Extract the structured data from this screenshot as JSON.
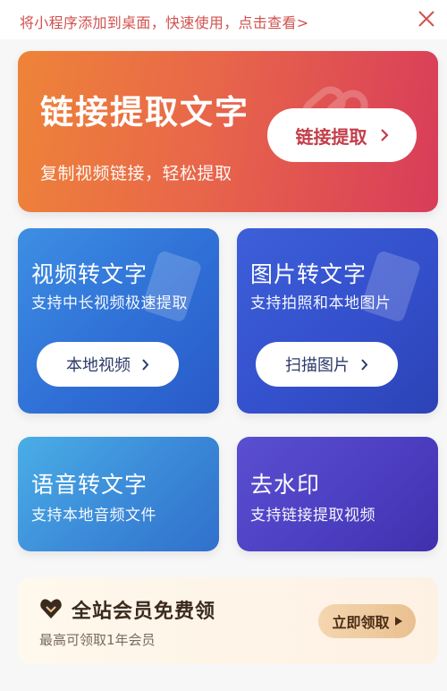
{
  "topbar": {
    "tip": "将小程序添加到桌面，快速使用，点击查看>",
    "close_icon": "close-icon"
  },
  "hero": {
    "title": "链接提取文字",
    "subtitle": "复制视频链接，轻松提取",
    "button_label": "链接提取"
  },
  "video_card": {
    "title": "视频转文字",
    "subtitle": "支持中长视频极速提取",
    "button_label": "本地视频"
  },
  "image_card": {
    "title": "图片转文字",
    "subtitle": "支持拍照和本地图片",
    "button_label": "扫描图片"
  },
  "audio_card": {
    "title": "语音转文字",
    "subtitle": "支持本地音频文件"
  },
  "watermark_card": {
    "title": "去水印",
    "subtitle": "支持链接提取视频"
  },
  "member": {
    "title": "全站会员免费领",
    "subtitle": "最高可领取1年会员",
    "button_label": "立即领取"
  },
  "colors": {
    "tip_text": "#d2524f",
    "hero_start": "#ee8438",
    "hero_end": "#d83c5a",
    "video_blue": "#2f6fd6",
    "image_blue": "#3450cc",
    "audio_blue": "#3b89d8",
    "watermark_purple": "#4d3fc2",
    "member_gold": "#e9c090"
  }
}
